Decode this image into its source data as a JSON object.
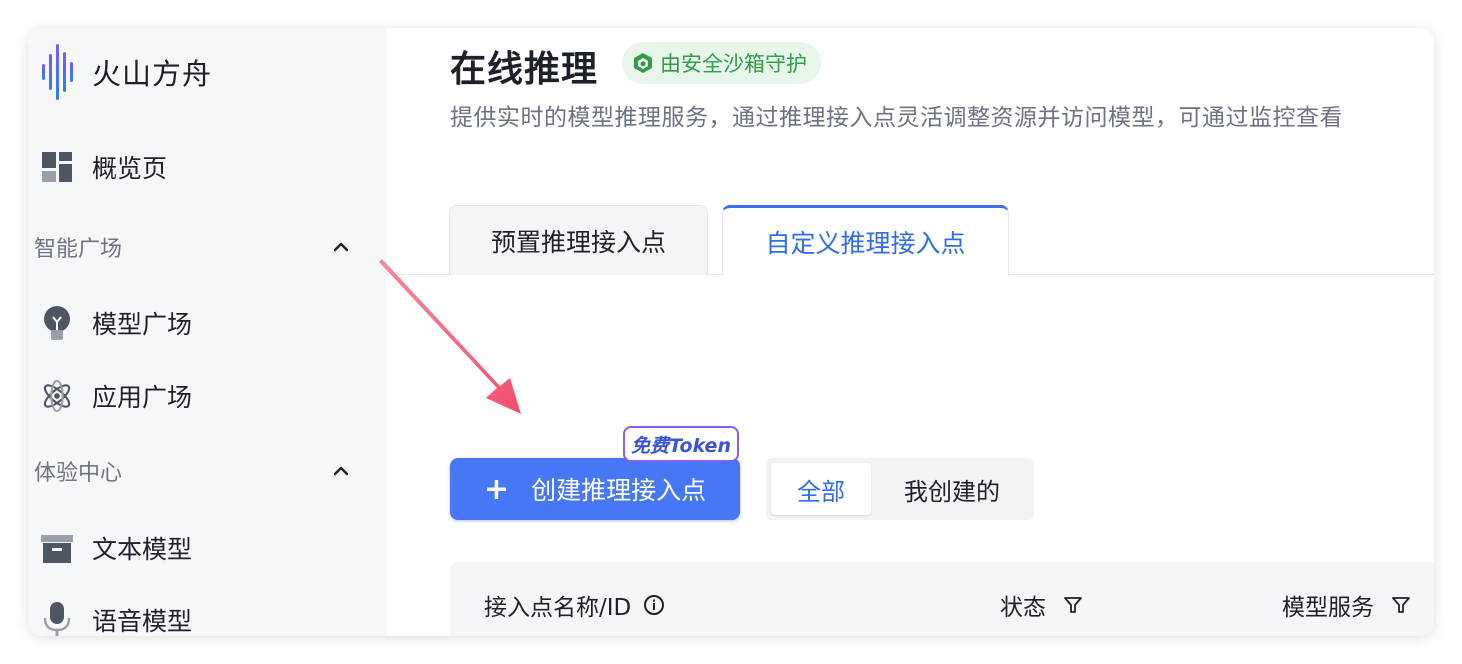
{
  "app": {
    "brand_name": "火山方舟"
  },
  "sidebar": {
    "overview_label": "概览页",
    "groups": [
      {
        "title": "智能广场",
        "items": [
          {
            "label": "模型广场",
            "icon": "bulb-icon"
          },
          {
            "label": "应用广场",
            "icon": "atom-icon"
          }
        ]
      },
      {
        "title": "体验中心",
        "items": [
          {
            "label": "文本模型",
            "icon": "archive-icon"
          },
          {
            "label": "语音模型",
            "icon": "microphone-icon"
          }
        ]
      }
    ]
  },
  "page": {
    "title": "在线推理",
    "badge": "由安全沙箱守护",
    "description": "提供实时的模型推理服务，通过推理接入点灵活调整资源并访问模型，可通过监控查看"
  },
  "tabs": [
    {
      "label": "预置推理接入点",
      "active": false
    },
    {
      "label": "自定义推理接入点",
      "active": true
    }
  ],
  "actions": {
    "create_label": "创建推理接入点",
    "create_icon": "plus-icon",
    "token_badge": "免费Token"
  },
  "filter": {
    "options": [
      "全部",
      "我创建的"
    ],
    "selected": "全部"
  },
  "table": {
    "columns": [
      {
        "label": "接入点名称/ID",
        "icon": "info-icon"
      },
      {
        "label": "状态",
        "icon": "filter-icon"
      },
      {
        "label": "模型服务",
        "icon": "filter-icon"
      }
    ]
  },
  "colors": {
    "accent": "#4677f5",
    "active_tab_text": "#2f6cf0",
    "badge_green": "#2f9e44",
    "annotation_arrow": "#f0506e"
  }
}
